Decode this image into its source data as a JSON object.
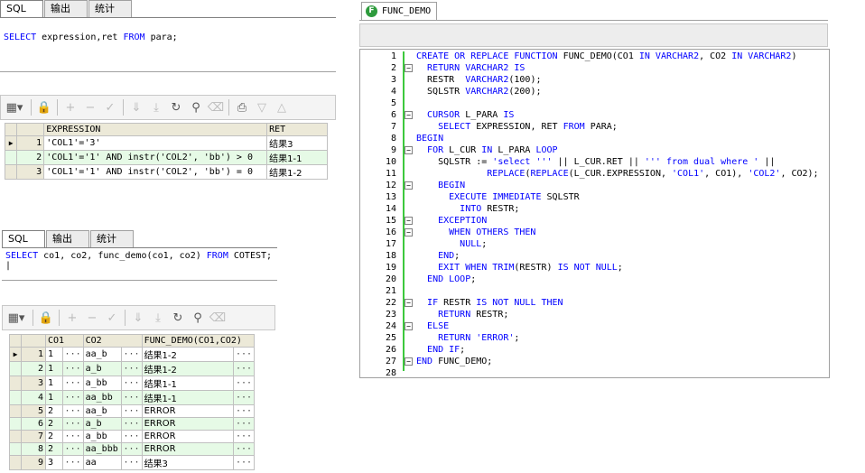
{
  "left_top": {
    "tabs": [
      "SQL",
      "输出",
      "统计"
    ],
    "sql_parts": [
      "SELECT",
      " expression,ret ",
      "FROM",
      " para;"
    ],
    "columns": [
      "EXPRESSION",
      "RET"
    ],
    "rows": [
      {
        "n": "1",
        "expr": "'COL1'='3'",
        "ret": "结果3"
      },
      {
        "n": "2",
        "expr": "'COL1'='1' AND instr('COL2', 'bb') > 0",
        "ret": "结果1-1"
      },
      {
        "n": "3",
        "expr": "'COL1'='1' AND instr('COL2', 'bb') = 0",
        "ret": "结果1-2"
      }
    ]
  },
  "left_bottom": {
    "tabs": [
      "SQL",
      "输出",
      "统计"
    ],
    "sql_parts": [
      "SELECT",
      " co1, co2, func_demo(co1, co2) ",
      "FROM",
      " COTEST;"
    ],
    "columns": [
      "CO1",
      "CO2",
      "FUNC_DEMO(CO1,CO2)"
    ],
    "rows": [
      {
        "n": "1",
        "co1": "1",
        "co2": "aa_b",
        "fd": "结果1-2"
      },
      {
        "n": "2",
        "co1": "1",
        "co2": "a_b",
        "fd": "结果1-2"
      },
      {
        "n": "3",
        "co1": "1",
        "co2": "a_bb",
        "fd": "结果1-1"
      },
      {
        "n": "4",
        "co1": "1",
        "co2": "aa_bb",
        "fd": "结果1-1"
      },
      {
        "n": "5",
        "co1": "2",
        "co2": "aa_b",
        "fd": "ERROR"
      },
      {
        "n": "6",
        "co1": "2",
        "co2": "a_b",
        "fd": "ERROR"
      },
      {
        "n": "7",
        "co1": "2",
        "co2": "a_bb",
        "fd": "ERROR"
      },
      {
        "n": "8",
        "co1": "2",
        "co2": "aa_bbb",
        "fd": "ERROR"
      },
      {
        "n": "9",
        "co1": "3",
        "co2": "aa",
        "fd": "结果3"
      }
    ]
  },
  "editor": {
    "tab_label": "FUNC_DEMO",
    "tab_icon_letter": "F",
    "line_numbers": [
      "1",
      "2",
      "3",
      "4",
      "5",
      "6",
      "7",
      "8",
      "9",
      "10",
      "11",
      "12",
      "13",
      "14",
      "15",
      "16",
      "17",
      "18",
      "19",
      "20",
      "21",
      "22",
      "23",
      "24",
      "25",
      "26",
      "27",
      "28"
    ],
    "lines": [
      [
        [
          "k",
          "CREATE OR REPLACE FUNCTION"
        ],
        [
          "t",
          " FUNC_DEMO(CO1 "
        ],
        [
          "k",
          "IN VARCHAR2"
        ],
        [
          "t",
          ", CO2 "
        ],
        [
          "k",
          "IN VARCHAR2"
        ],
        [
          "t",
          ")"
        ]
      ],
      [
        [
          "t",
          "  "
        ],
        [
          "k",
          "RETURN VARCHAR2 IS"
        ]
      ],
      [
        [
          "t",
          "  RESTR  "
        ],
        [
          "k",
          "VARCHAR2"
        ],
        [
          "t",
          "(100);"
        ]
      ],
      [
        [
          "t",
          "  SQLSTR "
        ],
        [
          "k",
          "VARCHAR2"
        ],
        [
          "t",
          "(200);"
        ]
      ],
      [
        [
          "t",
          ""
        ]
      ],
      [
        [
          "t",
          "  "
        ],
        [
          "k",
          "CURSOR"
        ],
        [
          "t",
          " L_PARA "
        ],
        [
          "k",
          "IS"
        ]
      ],
      [
        [
          "t",
          "    "
        ],
        [
          "k",
          "SELECT"
        ],
        [
          "t",
          " EXPRESSION, RET "
        ],
        [
          "k",
          "FROM"
        ],
        [
          "t",
          " PARA;"
        ]
      ],
      [
        [
          "k",
          "BEGIN"
        ]
      ],
      [
        [
          "t",
          "  "
        ],
        [
          "k",
          "FOR"
        ],
        [
          "t",
          " L_CUR "
        ],
        [
          "k",
          "IN"
        ],
        [
          "t",
          " L_PARA "
        ],
        [
          "k",
          "LOOP"
        ]
      ],
      [
        [
          "t",
          "    SQLSTR := "
        ],
        [
          "s",
          "'select ''' "
        ],
        [
          "t",
          "|| L_CUR.RET || "
        ],
        [
          "s",
          "''' from dual where ' "
        ],
        [
          "t",
          "||"
        ]
      ],
      [
        [
          "t",
          "             "
        ],
        [
          "k",
          "REPLACE"
        ],
        [
          "t",
          "("
        ],
        [
          "k",
          "REPLACE"
        ],
        [
          "t",
          "(L_CUR.EXPRESSION, "
        ],
        [
          "s",
          "'COL1'"
        ],
        [
          "t",
          ", CO1), "
        ],
        [
          "s",
          "'COL2'"
        ],
        [
          "t",
          ", CO2);"
        ]
      ],
      [
        [
          "t",
          "    "
        ],
        [
          "k",
          "BEGIN"
        ]
      ],
      [
        [
          "t",
          "      "
        ],
        [
          "k",
          "EXECUTE IMMEDIATE"
        ],
        [
          "t",
          " SQLSTR"
        ]
      ],
      [
        [
          "t",
          "        "
        ],
        [
          "k",
          "INTO"
        ],
        [
          "t",
          " RESTR;"
        ]
      ],
      [
        [
          "t",
          "    "
        ],
        [
          "k",
          "EXCEPTION"
        ]
      ],
      [
        [
          "t",
          "      "
        ],
        [
          "k",
          "WHEN OTHERS THEN"
        ]
      ],
      [
        [
          "t",
          "        "
        ],
        [
          "k",
          "NULL"
        ],
        [
          "t",
          ";"
        ]
      ],
      [
        [
          "t",
          "    "
        ],
        [
          "k",
          "END"
        ],
        [
          "t",
          ";"
        ]
      ],
      [
        [
          "t",
          "    "
        ],
        [
          "k",
          "EXIT WHEN TRIM"
        ],
        [
          "t",
          "(RESTR) "
        ],
        [
          "k",
          "IS NOT NULL"
        ],
        [
          "t",
          ";"
        ]
      ],
      [
        [
          "t",
          "  "
        ],
        [
          "k",
          "END LOOP"
        ],
        [
          "t",
          ";"
        ]
      ],
      [
        [
          "t",
          ""
        ]
      ],
      [
        [
          "t",
          "  "
        ],
        [
          "k",
          "IF"
        ],
        [
          "t",
          " RESTR "
        ],
        [
          "k",
          "IS NOT NULL THEN"
        ]
      ],
      [
        [
          "t",
          "    "
        ],
        [
          "k",
          "RETURN"
        ],
        [
          "t",
          " RESTR;"
        ]
      ],
      [
        [
          "t",
          "  "
        ],
        [
          "k",
          "ELSE"
        ]
      ],
      [
        [
          "t",
          "    "
        ],
        [
          "k",
          "RETURN"
        ],
        [
          "s",
          " 'ERROR'"
        ],
        [
          "t",
          ";"
        ]
      ],
      [
        [
          "t",
          "  "
        ],
        [
          "k",
          "END IF"
        ],
        [
          "t",
          ";"
        ]
      ],
      [
        [
          "k",
          "END"
        ],
        [
          "t",
          " FUNC_DEMO;"
        ]
      ],
      [
        [
          "t",
          ""
        ]
      ]
    ],
    "fold_lines": [
      2,
      6,
      9,
      12,
      15,
      16,
      22,
      24,
      27
    ],
    "colors": {
      "keyword": "#0000ff",
      "string": "#0000ff",
      "text": "#000000",
      "change_bar": "#3dc83d",
      "alt_row": "#e6fae6"
    }
  }
}
